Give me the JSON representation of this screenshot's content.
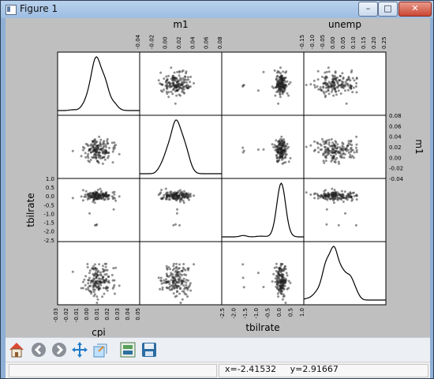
{
  "window": {
    "title": "Figure 1",
    "controls": {
      "minimize": "–",
      "maximize": "□",
      "close": "✕"
    }
  },
  "toolbar": {
    "buttons": [
      "home-icon",
      "back-icon",
      "forward-icon",
      "pan-icon",
      "zoom-icon",
      "configure-subplots-icon",
      "save-icon"
    ]
  },
  "status": {
    "readout": "x=-2.41532     y=2.91667"
  },
  "chart_data": {
    "type": "scatter",
    "variables": [
      "cpi",
      "m1",
      "tbilrate",
      "unemp"
    ],
    "diagonal": "kde",
    "labels": {
      "bottom_left": "cpi",
      "bottom_third": "tbilrate",
      "top_second": "m1",
      "top_fourth": "unemp",
      "left_third": "tbilrate",
      "right_second": "m1"
    },
    "ticks": {
      "cpi": [
        "-0.03",
        "-0.02",
        "-0.01",
        "0.00",
        "0.01",
        "0.02",
        "0.03",
        "0.04",
        "0.05"
      ],
      "m1_top": [
        "-0.04",
        "-0.02",
        "0.00",
        "0.02",
        "0.04",
        "0.06",
        "0.08"
      ],
      "unemp_top": [
        "-0.15",
        "-0.10",
        "-0.05",
        "0.00",
        "0.05",
        "0.10",
        "0.15",
        "0.20",
        "0.25"
      ],
      "m1_right": [
        "0.08",
        "0.06",
        "0.04",
        "0.02",
        "0.00",
        "-0.02",
        "-0.04"
      ],
      "tbilrate_left": [
        "1.0",
        "0.5",
        "0.0",
        "-0.5",
        "-1.0",
        "-1.5",
        "-2.0",
        "-2.5"
      ],
      "tbilrate_bottom": [
        "-2.5",
        "-2.0",
        "-1.5",
        "-1.0",
        "-0.5",
        "0.0",
        "0.5",
        "1.0"
      ]
    },
    "ranges": {
      "cpi": [
        -0.03,
        0.05
      ],
      "m1": [
        -0.04,
        0.08
      ],
      "tbilrate": [
        -2.6,
        1.0
      ],
      "unemp": [
        -0.15,
        0.25
      ]
    },
    "sample_count": 160,
    "colors": {
      "points": "#222222",
      "kde": "#000000",
      "panel": "#ffffff",
      "background": "#bfbfbf"
    }
  }
}
